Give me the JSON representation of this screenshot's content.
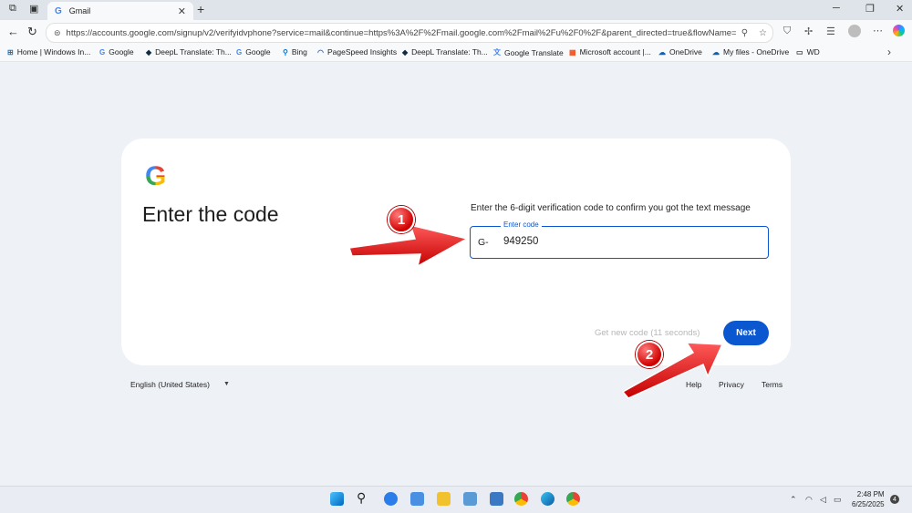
{
  "browser": {
    "tab_title": "Gmail",
    "tab_favicon": "G",
    "url": "https://accounts.google.com/signup/v2/verifyidvphone?service=mail&continue=https%3A%2F%2Fmail.google.com%2Fmail%2Fu%2F0%2F&parent_directed=true&flowName=GlifWebSignIn",
    "icons": [
      "workspaces-icon",
      "vertical-tabs-icon",
      "back-icon",
      "refresh-icon",
      "site-info-icon",
      "read-aloud-icon",
      "favorite-star-icon",
      "browser-essentials-icon",
      "extensions-icon",
      "favorites-icon",
      "profile-icon",
      "copilot-icon",
      "minimize-icon",
      "maximize-icon",
      "close-icon"
    ]
  },
  "bookmarks": [
    {
      "label": "Home | Windows In...",
      "icon": "windows-icon",
      "glyph": "⊞",
      "color": "#0078d4"
    },
    {
      "label": "Google",
      "icon": "google-icon",
      "glyph": "G",
      "color": "#4285f4"
    },
    {
      "label": "DeepL Translate: Th...",
      "icon": "deepl-icon",
      "glyph": "◆",
      "color": "#0f2b46"
    },
    {
      "label": "Google",
      "icon": "google-icon",
      "glyph": "G",
      "color": "#4285f4"
    },
    {
      "label": "Bing",
      "icon": "bing-search-icon",
      "glyph": "⚲",
      "color": "#0078d4"
    },
    {
      "label": "PageSpeed Insights",
      "icon": "pagespeed-icon",
      "glyph": "◠",
      "color": "#1a73e8"
    },
    {
      "label": "DeepL Translate: Th...",
      "icon": "deepl-icon",
      "glyph": "◆",
      "color": "#0f2b46"
    },
    {
      "label": "Google Translate",
      "icon": "google-translate-icon",
      "glyph": "文",
      "color": "#4285f4"
    },
    {
      "label": "Microsoft account |...",
      "icon": "microsoft-icon",
      "glyph": "▦",
      "color": "#f25022"
    },
    {
      "label": "OneDrive",
      "icon": "onedrive-icon",
      "glyph": "☁",
      "color": "#0364b8"
    },
    {
      "label": "My files - OneDrive",
      "icon": "onedrive-icon",
      "glyph": "☁",
      "color": "#0364b8"
    },
    {
      "label": "WD",
      "icon": "folder-icon",
      "glyph": "▭",
      "color": "#444444"
    }
  ],
  "page": {
    "heading": "Enter the code",
    "instruction": "Enter the 6-digit verification code to confirm you got the text message",
    "field_label": "Enter code",
    "prefix": "G-",
    "code_value": "949250",
    "resend_text": "Get new code (11 seconds)",
    "next_label": "Next",
    "accent_color": "#0b57d0"
  },
  "footer": {
    "language": "English (United States)",
    "help": "Help",
    "privacy": "Privacy",
    "terms": "Terms"
  },
  "annotations": {
    "badge1": "1",
    "badge2": "2",
    "arrow_color": "#e60000"
  },
  "taskbar": {
    "time": "2:48 PM",
    "date": "6/25/2025",
    "notification_count": "4"
  }
}
